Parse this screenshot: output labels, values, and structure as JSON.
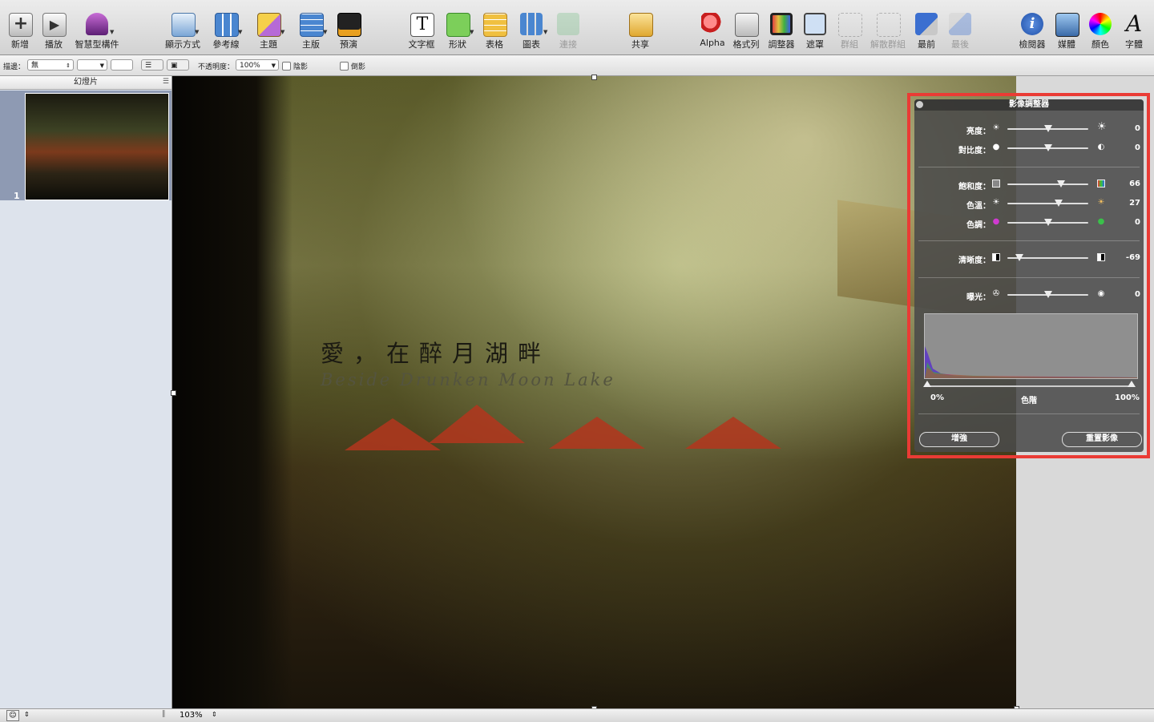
{
  "toolbar": {
    "items": [
      {
        "label": "新增",
        "icon": "plus-icon"
      },
      {
        "label": "播放",
        "icon": "play-icon"
      },
      {
        "label": "智慧型構件",
        "icon": "smart-build-icon"
      },
      {
        "label": "顯示方式",
        "icon": "view-icon"
      },
      {
        "label": "參考線",
        "icon": "guides-icon"
      },
      {
        "label": "主題",
        "icon": "themes-icon"
      },
      {
        "label": "主版",
        "icon": "masters-icon"
      },
      {
        "label": "預演",
        "icon": "rehearse-icon"
      },
      {
        "label": "文字框",
        "icon": "text-box-icon"
      },
      {
        "label": "形狀",
        "icon": "shapes-icon"
      },
      {
        "label": "表格",
        "icon": "table-icon"
      },
      {
        "label": "圖表",
        "icon": "chart-icon"
      },
      {
        "label": "連接",
        "icon": "connect-icon"
      },
      {
        "label": "共享",
        "icon": "share-icon"
      },
      {
        "label": "Alpha",
        "icon": "alpha-icon"
      },
      {
        "label": "格式列",
        "icon": "format-bar-icon"
      },
      {
        "label": "調整器",
        "icon": "adjust-icon"
      },
      {
        "label": "遮罩",
        "icon": "mask-icon"
      },
      {
        "label": "群組",
        "icon": "group-icon"
      },
      {
        "label": "解散群組",
        "icon": "ungroup-icon"
      },
      {
        "label": "最前",
        "icon": "bring-front-icon"
      },
      {
        "label": "最後",
        "icon": "send-back-icon"
      },
      {
        "label": "檢閱器",
        "icon": "inspector-icon"
      },
      {
        "label": "媒體",
        "icon": "media-icon"
      },
      {
        "label": "顏色",
        "icon": "colors-icon"
      },
      {
        "label": "字體",
        "icon": "fonts-icon"
      }
    ]
  },
  "format_bar": {
    "stroke_label": "描邊：",
    "stroke_value": "無",
    "opacity_label": "不透明度：",
    "opacity_value": "100%",
    "shadow_label": "陰影",
    "reflection_label": "倒影"
  },
  "navigator": {
    "header": "幻燈片",
    "slide_number": "1"
  },
  "slide": {
    "title": "愛，在醉月湖畔",
    "subtitle": "Beside Drunken Moon Lake"
  },
  "image_adjust": {
    "title": "影像調整器",
    "rows": [
      {
        "label": "亮度：",
        "value": "0",
        "level": 0.5
      },
      {
        "label": "對比度：",
        "value": "0",
        "level": 0.5
      },
      {
        "label": "飽和度：",
        "value": "66",
        "level": 0.66
      },
      {
        "label": "色溫：",
        "value": "27",
        "level": 0.63
      },
      {
        "label": "色調：",
        "value": "0",
        "level": 0.5
      },
      {
        "label": "清晰度：",
        "value": "-69",
        "level": 0.15
      },
      {
        "label": "曝光：",
        "value": "0",
        "level": 0.5
      }
    ],
    "levels_min_label": "0%",
    "levels_label": "色階",
    "levels_max_label": "100%",
    "enhance_button": "增強",
    "reset_button": "重置影像"
  },
  "bottom": {
    "zoom": "103%"
  },
  "colors": {
    "highlight": "#ea3b35",
    "panel_bg": "#4a4a4a"
  }
}
